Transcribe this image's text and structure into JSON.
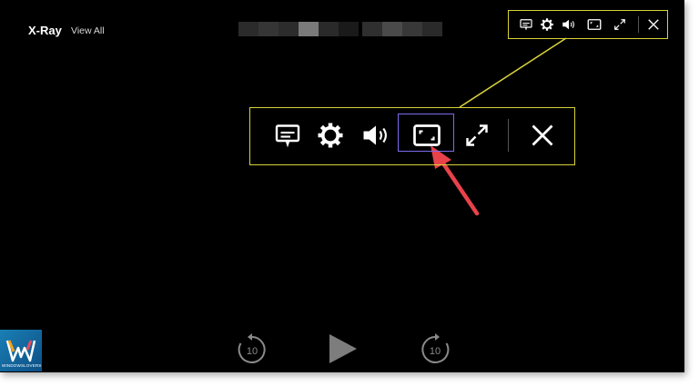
{
  "header": {
    "title": "X-Ray",
    "view_all_label": "View All"
  },
  "player_toolbar": {
    "icons": [
      "captions-icon",
      "gear-icon",
      "volume-icon",
      "picture-in-picture-icon",
      "fullscreen-icon",
      "close-icon"
    ]
  },
  "zoomed_toolbar": {
    "highlighted_icon": "picture-in-picture-icon"
  },
  "playback": {
    "rewind_seconds": "10",
    "forward_seconds": "10"
  },
  "watermark": {
    "text": "WINDOWSLOVERS"
  },
  "colors": {
    "background": "#000000",
    "callout_border": "#d9d23a",
    "highlight_border": "#7b6cf0",
    "arrow": "#e8424b"
  }
}
